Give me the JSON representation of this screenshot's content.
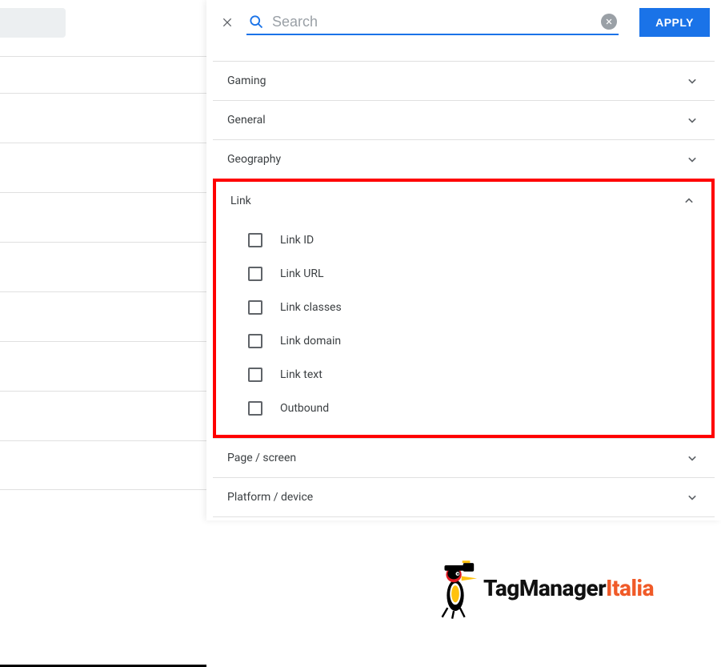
{
  "header": {
    "search_placeholder": "Search",
    "apply_label": "APPLY"
  },
  "accordion": {
    "sections": [
      {
        "label": "Gaming",
        "expanded": false
      },
      {
        "label": "General",
        "expanded": false
      },
      {
        "label": "Geography",
        "expanded": false
      },
      {
        "label": "Link",
        "expanded": true,
        "highlighted": true
      },
      {
        "label": "Page / screen",
        "expanded": false
      },
      {
        "label": "Platform / device",
        "expanded": false
      }
    ],
    "link_items": [
      {
        "label": "Link ID",
        "checked": false
      },
      {
        "label": "Link URL",
        "checked": false
      },
      {
        "label": "Link classes",
        "checked": false
      },
      {
        "label": "Link domain",
        "checked": false
      },
      {
        "label": "Link text",
        "checked": false
      },
      {
        "label": "Outbound",
        "checked": false
      }
    ]
  },
  "logo": {
    "text_main": "TagManager",
    "text_accent": "Italia"
  }
}
